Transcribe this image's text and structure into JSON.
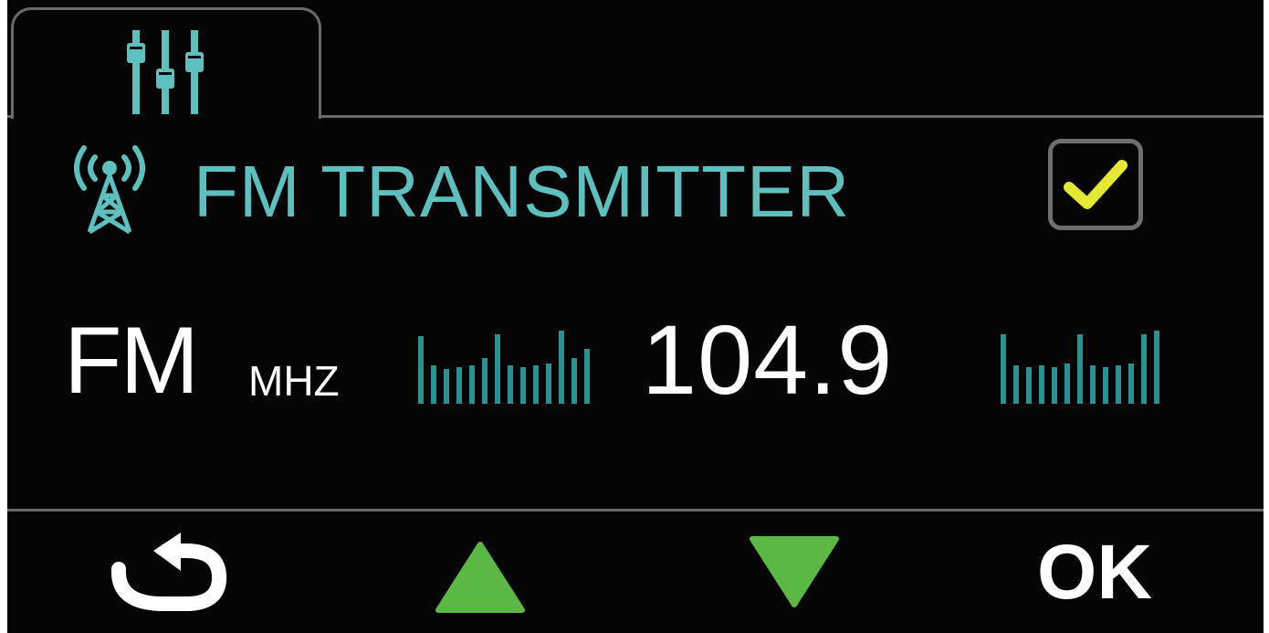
{
  "tab": {
    "icon": "equalizer-sliders-icon"
  },
  "header": {
    "icon": "antenna-tower-icon",
    "title": "FM TRANSMITTER",
    "checkbox_checked": true
  },
  "frequency": {
    "band": "FM",
    "unit": "MHZ",
    "value": "104.9"
  },
  "footer": {
    "back_icon": "back-arrow-icon",
    "up_icon": "up-triangle-icon",
    "down_icon": "down-triangle-icon",
    "ok_label": "OK"
  },
  "colors": {
    "background": "#050505",
    "accent": "#5ebfbf",
    "bars": "#2a9090",
    "check": "#e5e832",
    "arrows": "#5bb844",
    "text": "#ffffff",
    "border": "#6a6a6a"
  }
}
